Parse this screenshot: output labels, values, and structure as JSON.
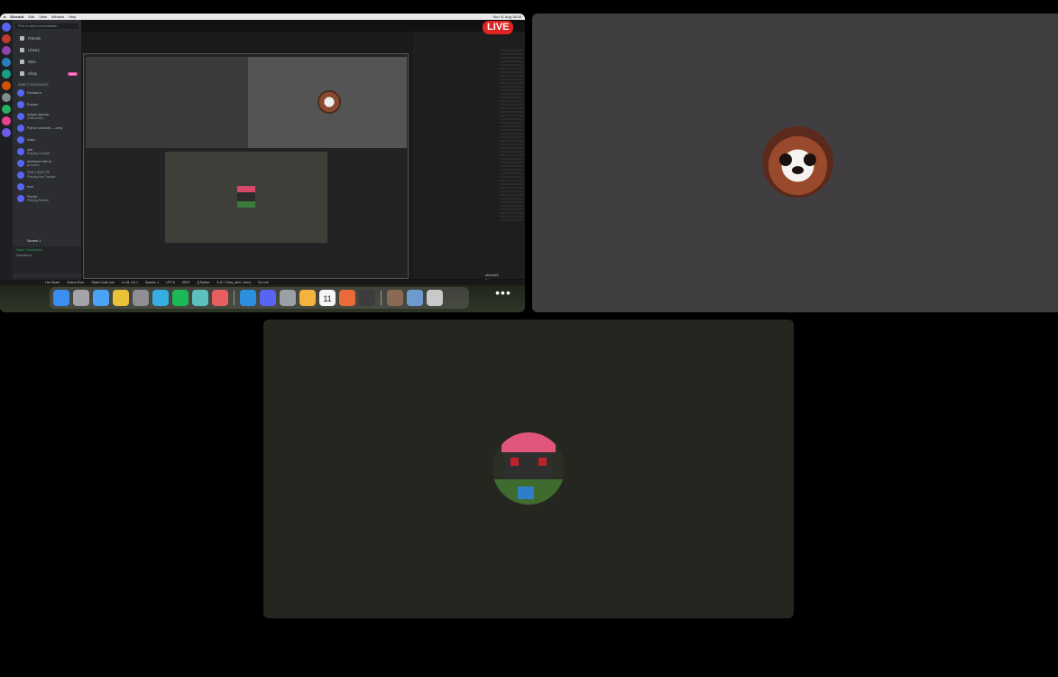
{
  "screen_share": {
    "live_badge": "LIVE",
    "menubar": {
      "app_name": "Discord",
      "items": [
        "Edit",
        "View",
        "Window",
        "Help"
      ],
      "clock": "Sun 11 Aug 18:33"
    },
    "discord": {
      "search_placeholder": "Find or start a conversation",
      "nav": [
        {
          "label": "Friends",
          "icon": "friends-icon"
        },
        {
          "label": "Library",
          "icon": "library-icon"
        },
        {
          "label": "Nitro",
          "icon": "nitro-icon"
        },
        {
          "label": "Shop",
          "icon": "shop-icon",
          "badge": "NEW"
        }
      ],
      "direct_messages_header": "DIRECT MESSAGES",
      "direct_messages": [
        {
          "name": "DennisLin",
          "status": ""
        },
        {
          "name": "Pussbe",
          "status": ""
        },
        {
          "name": "unique ripsnow",
          "status": "3 Members"
        },
        {
          "name": "Python shooterfi — certy",
          "status": ""
        },
        {
          "name": "hutes",
          "status": ""
        },
        {
          "name": "real",
          "status": "Playing Counter"
        },
        {
          "name": "amethyst ruler pv",
          "status": "pvxdrum"
        },
        {
          "name": "ⓑⓑⓘⓖⓔⓡⓑ",
          "status": "Playing Ace Tracker"
        },
        {
          "name": "hoot",
          "status": ""
        },
        {
          "name": "FireZer",
          "status": "Playing Roblox"
        }
      ],
      "screen_label": "Screen 1",
      "voice_status": "Voice Connected",
      "voice_channel": "DennisLin",
      "user_name": "hape",
      "user_status": "Online"
    },
    "statusbar": [
      "Live Share",
      "Search Error",
      "Share Code Link",
      "Ln 18, Col 1",
      "Spaces: 4",
      "UTF-8",
      "CRLF",
      "{} Python",
      "3.11.7 ('kivy_venv': venv)",
      "Go Live"
    ],
    "editor_terminal": [
      "zsh Anx2",
      "Python"
    ],
    "dock_apps": [
      {
        "name": "Finder",
        "color": "#3b8ff3"
      },
      {
        "name": "Launchpad",
        "color": "#a3a3a8"
      },
      {
        "name": "Safari",
        "color": "#4aa3f5"
      },
      {
        "name": "Chrome",
        "color": "#e9c23a"
      },
      {
        "name": "System Settings",
        "color": "#8e8e93"
      },
      {
        "name": "Telegram",
        "color": "#37aee2"
      },
      {
        "name": "Spotify",
        "color": "#1db954"
      },
      {
        "name": "Bike",
        "color": "#5bc0be"
      },
      {
        "name": "Stack",
        "color": "#e85d5d"
      },
      {
        "name": "VS Code",
        "color": "#2d8fe0"
      },
      {
        "name": "Discord",
        "color": "#5865f2"
      },
      {
        "name": "Preview",
        "color": "#9aa0a6"
      },
      {
        "name": "Photos",
        "color": "#f4b23f"
      },
      {
        "name": "Calendar",
        "color": "#f5f5f5"
      },
      {
        "name": "Instruments",
        "color": "#e96b3a"
      },
      {
        "name": "Kodi",
        "color": "#3c3c3c"
      },
      {
        "name": "Image Capture",
        "color": "#8a6a52"
      },
      {
        "name": "Downloads",
        "color": "#6d9bd0"
      },
      {
        "name": "Trash",
        "color": "#c9c9c9"
      }
    ],
    "calendar_day": "11",
    "more_label": "•••"
  },
  "participants": [
    {
      "name": "red-panda-participant",
      "avatar": "red-panda-avatar"
    },
    {
      "name": "creeper-participant",
      "avatar": "creeper-avatar"
    }
  ],
  "colors": {
    "tile_panda_bg": "#403e40",
    "tile_creeper_bg": "#24261f",
    "live_red": "#e02424",
    "discord_blurple": "#5865f2"
  }
}
